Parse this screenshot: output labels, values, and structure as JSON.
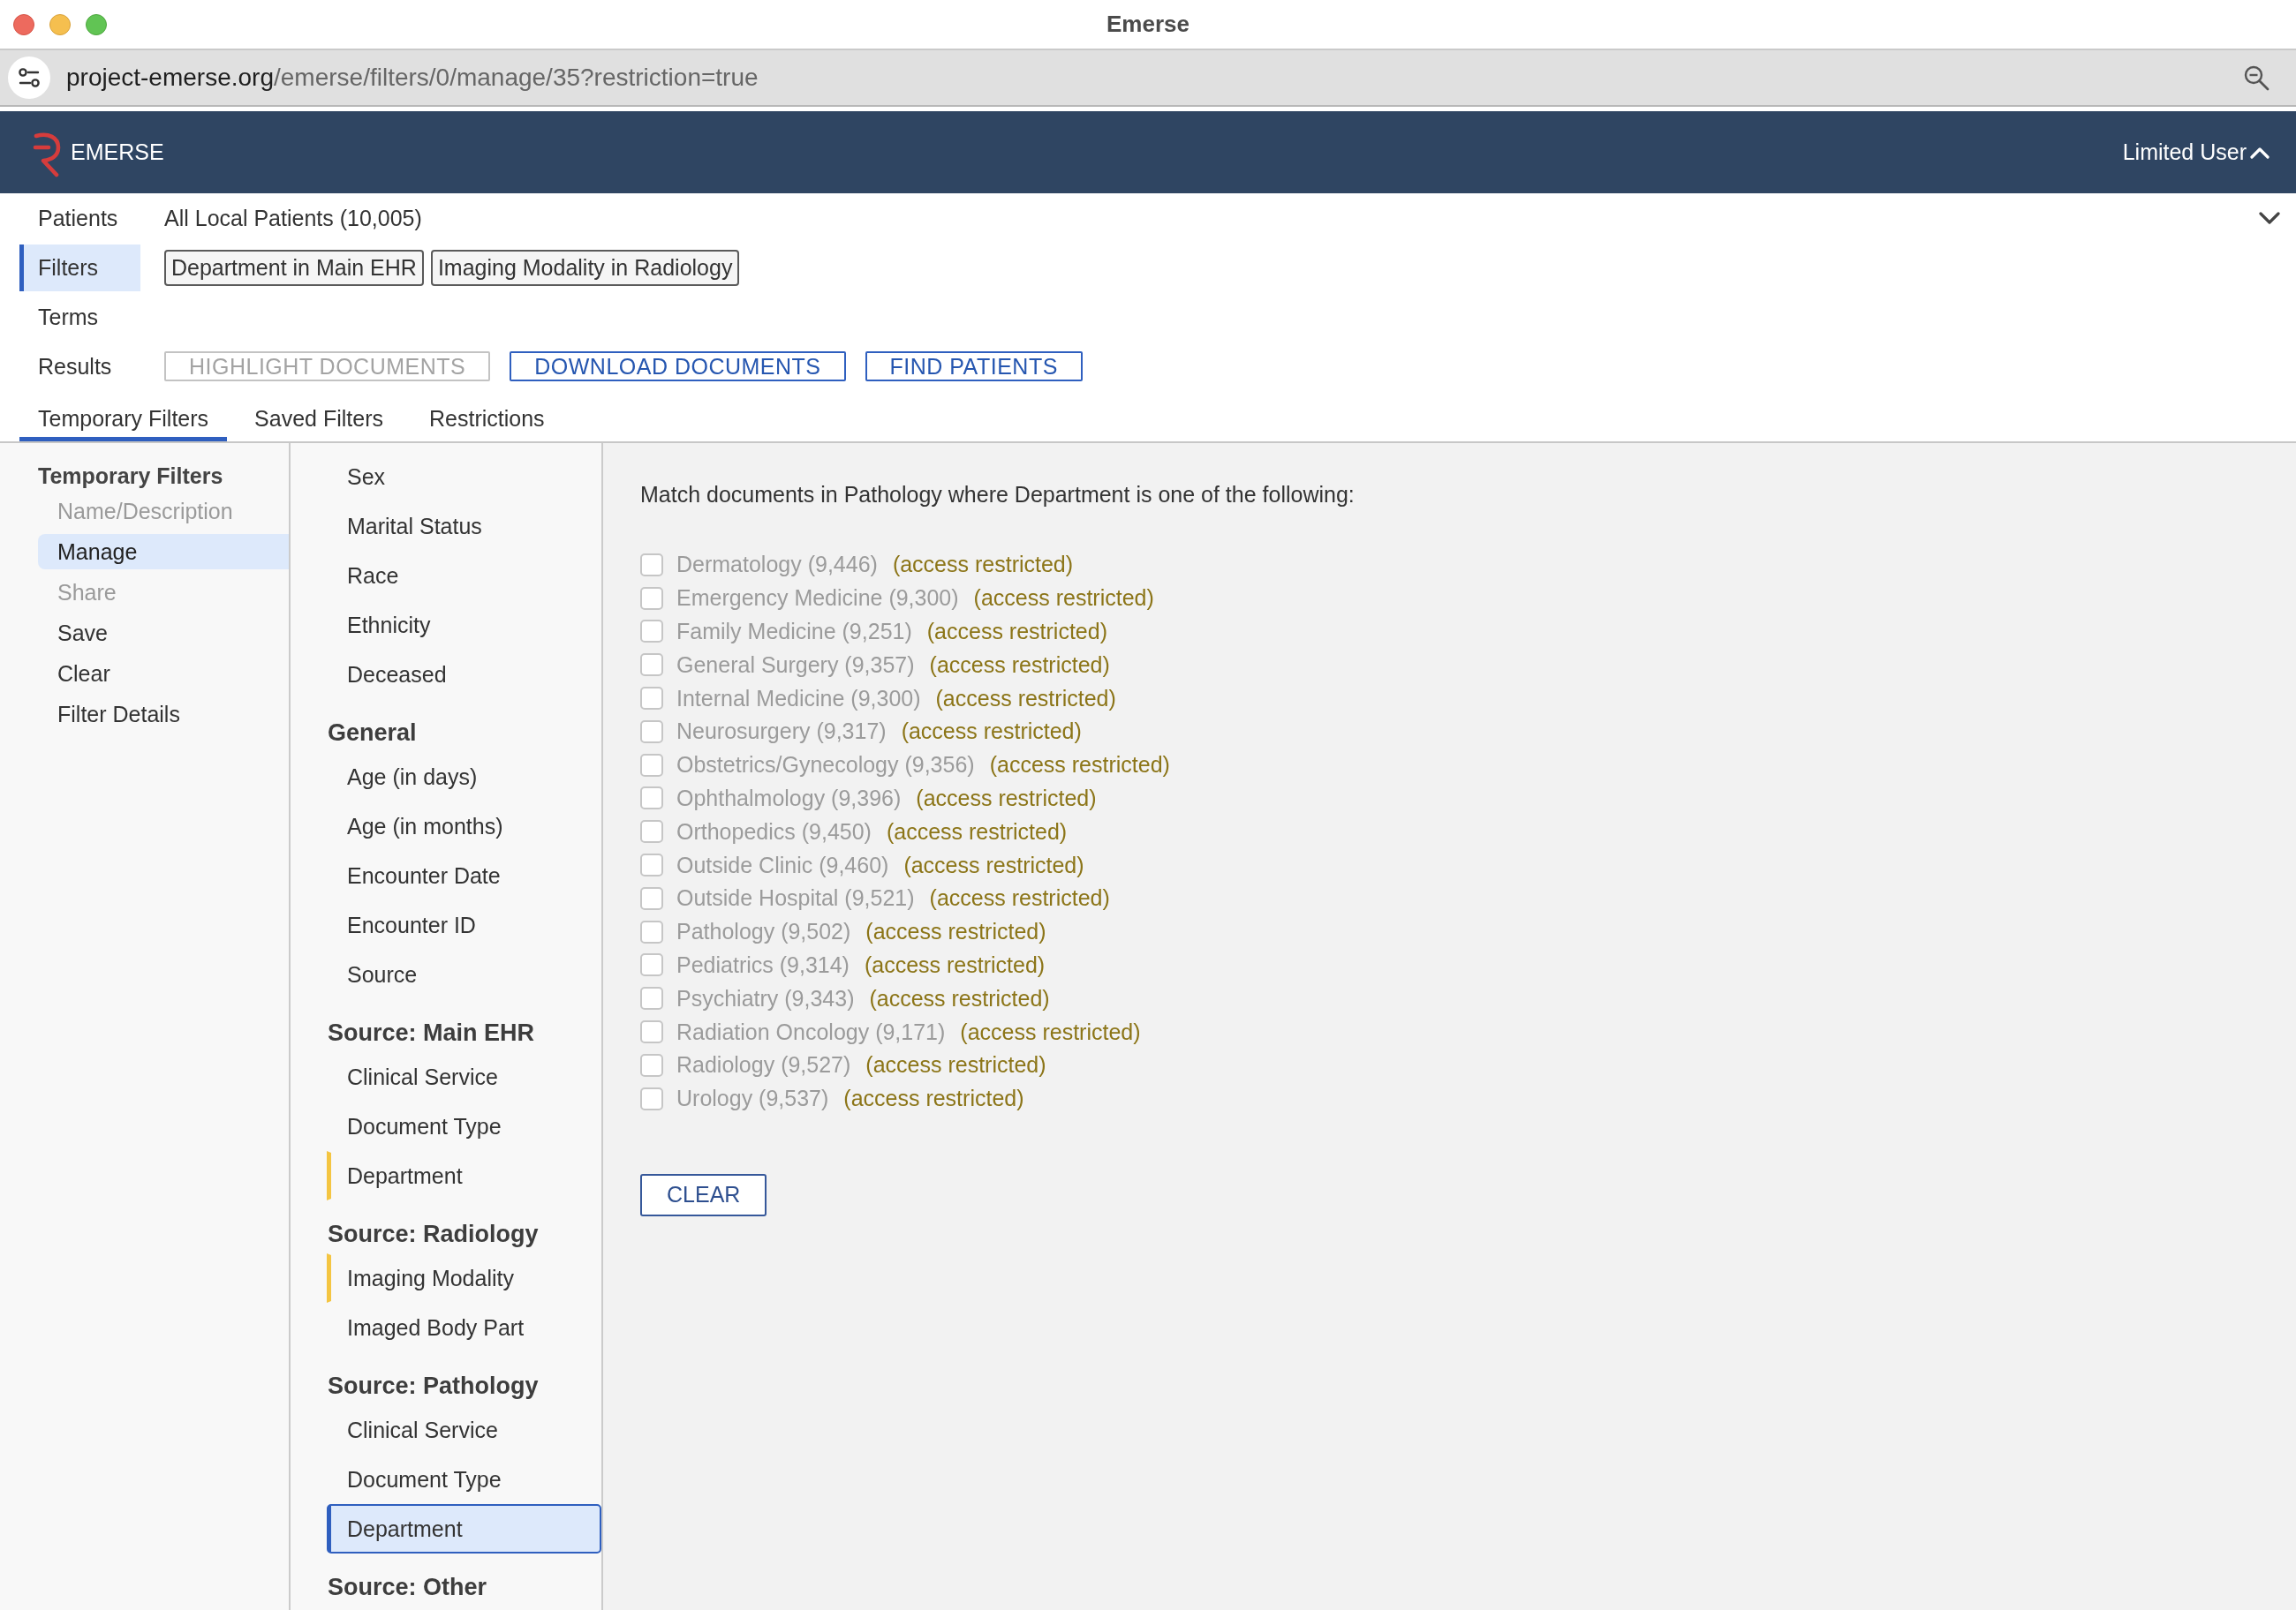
{
  "window": {
    "title": "Emerse"
  },
  "address_bar": {
    "host": "project-emerse.org",
    "path": "/emerse/filters/0/manage/35?restriction=true"
  },
  "app_header": {
    "brand": "EMERSE",
    "user_menu": "Limited User"
  },
  "query_panel": {
    "rows": [
      {
        "label": "Patients",
        "selected": false,
        "value": "All Local Patients (10,005)"
      },
      {
        "label": "Filters",
        "selected": true,
        "chips": [
          "Department in Main EHR",
          "Imaging Modality in Radiology"
        ]
      },
      {
        "label": "Terms",
        "selected": false
      },
      {
        "label": "Results",
        "selected": false,
        "buttons": [
          {
            "label": "HIGHLIGHT DOCUMENTS",
            "disabled": true
          },
          {
            "label": "DOWNLOAD DOCUMENTS",
            "disabled": false
          },
          {
            "label": "FIND PATIENTS",
            "disabled": false
          }
        ]
      }
    ]
  },
  "tabs": [
    {
      "label": "Temporary Filters",
      "selected": true
    },
    {
      "label": "Saved Filters",
      "selected": false
    },
    {
      "label": "Restrictions",
      "selected": false
    }
  ],
  "sidebar": {
    "title": "Temporary Filters",
    "items": [
      {
        "label": "Name/Description",
        "selected": false,
        "disabled": true
      },
      {
        "label": "Manage",
        "selected": true,
        "disabled": false
      },
      {
        "label": "Share",
        "selected": false,
        "disabled": true
      },
      {
        "label": "Save",
        "selected": false,
        "disabled": false
      },
      {
        "label": "Clear",
        "selected": false,
        "disabled": false
      },
      {
        "label": "Filter Details",
        "selected": false,
        "disabled": false
      }
    ]
  },
  "field_list": {
    "groups": [
      {
        "items": [
          {
            "label": "Sex",
            "in_use": false,
            "selected": false
          },
          {
            "label": "Marital Status",
            "in_use": false,
            "selected": false
          },
          {
            "label": "Race",
            "in_use": false,
            "selected": false
          },
          {
            "label": "Ethnicity",
            "in_use": false,
            "selected": false
          },
          {
            "label": "Deceased",
            "in_use": false,
            "selected": false
          }
        ]
      },
      {
        "heading": "General",
        "items": [
          {
            "label": "Age (in days)",
            "in_use": false,
            "selected": false
          },
          {
            "label": "Age (in months)",
            "in_use": false,
            "selected": false
          },
          {
            "label": "Encounter Date",
            "in_use": false,
            "selected": false
          },
          {
            "label": "Encounter ID",
            "in_use": false,
            "selected": false
          },
          {
            "label": "Source",
            "in_use": false,
            "selected": false
          }
        ]
      },
      {
        "heading": "Source: Main EHR",
        "items": [
          {
            "label": "Clinical Service",
            "in_use": false,
            "selected": false
          },
          {
            "label": "Document Type",
            "in_use": false,
            "selected": false
          },
          {
            "label": "Department",
            "in_use": true,
            "selected": false
          }
        ]
      },
      {
        "heading": "Source: Radiology",
        "items": [
          {
            "label": "Imaging Modality",
            "in_use": true,
            "selected": false
          },
          {
            "label": "Imaged Body Part",
            "in_use": false,
            "selected": false
          }
        ]
      },
      {
        "heading": "Source: Pathology",
        "items": [
          {
            "label": "Clinical Service",
            "in_use": false,
            "selected": false
          },
          {
            "label": "Document Type",
            "in_use": false,
            "selected": false
          },
          {
            "label": "Department",
            "in_use": false,
            "selected": true
          }
        ]
      },
      {
        "heading": "Source: Other"
      }
    ]
  },
  "content": {
    "description": "Match documents in Pathology where Department is one of the following:",
    "options": [
      {
        "label": "Dermatology (9,446)",
        "note": "(access restricted)",
        "checked": false,
        "disabled": true
      },
      {
        "label": "Emergency Medicine (9,300)",
        "note": "(access restricted)",
        "checked": false,
        "disabled": true
      },
      {
        "label": "Family Medicine (9,251)",
        "note": "(access restricted)",
        "checked": false,
        "disabled": true
      },
      {
        "label": "General Surgery (9,357)",
        "note": "(access restricted)",
        "checked": false,
        "disabled": true
      },
      {
        "label": "Internal Medicine (9,300)",
        "note": "(access restricted)",
        "checked": false,
        "disabled": true
      },
      {
        "label": "Neurosurgery (9,317)",
        "note": "(access restricted)",
        "checked": false,
        "disabled": true
      },
      {
        "label": "Obstetrics/Gynecology (9,356)",
        "note": "(access restricted)",
        "checked": false,
        "disabled": true
      },
      {
        "label": "Ophthalmology (9,396)",
        "note": "(access restricted)",
        "checked": false,
        "disabled": true
      },
      {
        "label": "Orthopedics (9,450)",
        "note": "(access restricted)",
        "checked": false,
        "disabled": true
      },
      {
        "label": "Outside Clinic (9,460)",
        "note": "(access restricted)",
        "checked": false,
        "disabled": true
      },
      {
        "label": "Outside Hospital (9,521)",
        "note": "(access restricted)",
        "checked": false,
        "disabled": true
      },
      {
        "label": "Pathology (9,502)",
        "note": "(access restricted)",
        "checked": false,
        "disabled": true
      },
      {
        "label": "Pediatrics (9,314)",
        "note": "(access restricted)",
        "checked": false,
        "disabled": true
      },
      {
        "label": "Psychiatry (9,343)",
        "note": "(access restricted)",
        "checked": false,
        "disabled": true
      },
      {
        "label": "Radiation Oncology (9,171)",
        "note": "(access restricted)",
        "checked": false,
        "disabled": true
      },
      {
        "label": "Radiology (9,527)",
        "note": "(access restricted)",
        "checked": false,
        "disabled": true
      },
      {
        "label": "Urology (9,537)",
        "note": "(access restricted)",
        "checked": false,
        "disabled": true
      }
    ],
    "clear_button": "CLEAR"
  }
}
